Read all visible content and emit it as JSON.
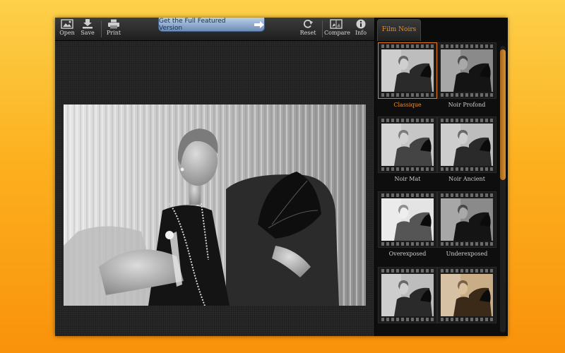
{
  "toolbar": {
    "open_label": "Open",
    "save_label": "Save",
    "print_label": "Print",
    "reset_label": "Reset",
    "compare_label": "Compare",
    "info_label": "Info"
  },
  "upgrade": {
    "label": "Get the Full Featured Version"
  },
  "sidebar": {
    "tab_label": "Film Noirs",
    "presets": [
      {
        "label": "Classique",
        "selected": true,
        "tone": "bw"
      },
      {
        "label": "Noir Profond",
        "selected": false,
        "tone": "bw-dark"
      },
      {
        "label": "Noir Mat",
        "selected": false,
        "tone": "bw-matte"
      },
      {
        "label": "Noir Ancient",
        "selected": false,
        "tone": "bw"
      },
      {
        "label": "Overexposed",
        "selected": false,
        "tone": "bw-light"
      },
      {
        "label": "Underexposed",
        "selected": false,
        "tone": "bw-dark"
      },
      {
        "label": "",
        "selected": false,
        "tone": "bw"
      },
      {
        "label": "",
        "selected": false,
        "tone": "sepia"
      }
    ]
  },
  "colors": {
    "accent": "#e8902a",
    "background_top": "#fdd04a",
    "background_bottom": "#f9920b"
  }
}
